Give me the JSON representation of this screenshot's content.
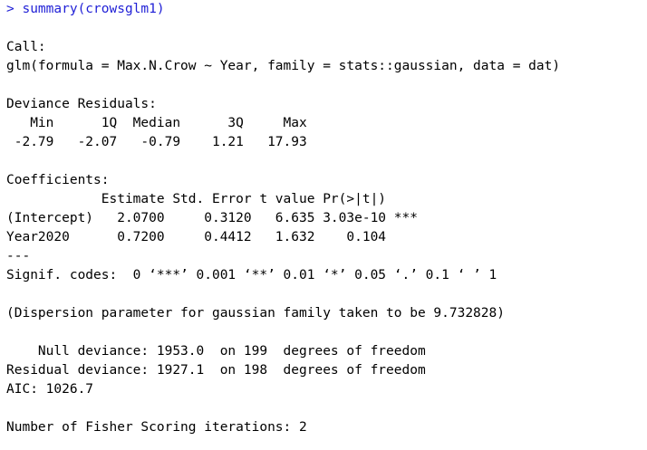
{
  "console": {
    "prompt": ">",
    "command": "summary(crowsglm1)",
    "output_lines": [
      "",
      "Call:",
      "glm(formula = Max.N.Crow ~ Year, family = stats::gaussian, data = dat)",
      "",
      "Deviance Residuals:",
      "   Min      1Q  Median      3Q     Max",
      " -2.79   -2.07   -0.79    1.21   17.93",
      "",
      "Coefficients:",
      "            Estimate Std. Error t value Pr(>|t|)",
      "(Intercept)   2.0700     0.3120   6.635 3.03e-10 ***",
      "Year2020      0.7200     0.4412   1.632    0.104",
      "---",
      "Signif. codes:  0 ‘***’ 0.001 ‘**’ 0.01 ‘*’ 0.05 ‘.’ 0.1 ‘ ’ 1",
      "",
      "(Dispersion parameter for gaussian family taken to be 9.732828)",
      "",
      "    Null deviance: 1953.0  on 199  degrees of freedom",
      "Residual deviance: 1927.1  on 198  degrees of freedom",
      "AIC: 1026.7",
      "",
      "Number of Fisher Scoring iterations: 2"
    ],
    "colors": {
      "command": "#1f1fd6",
      "output": "#000000",
      "background": "#ffffff"
    }
  }
}
